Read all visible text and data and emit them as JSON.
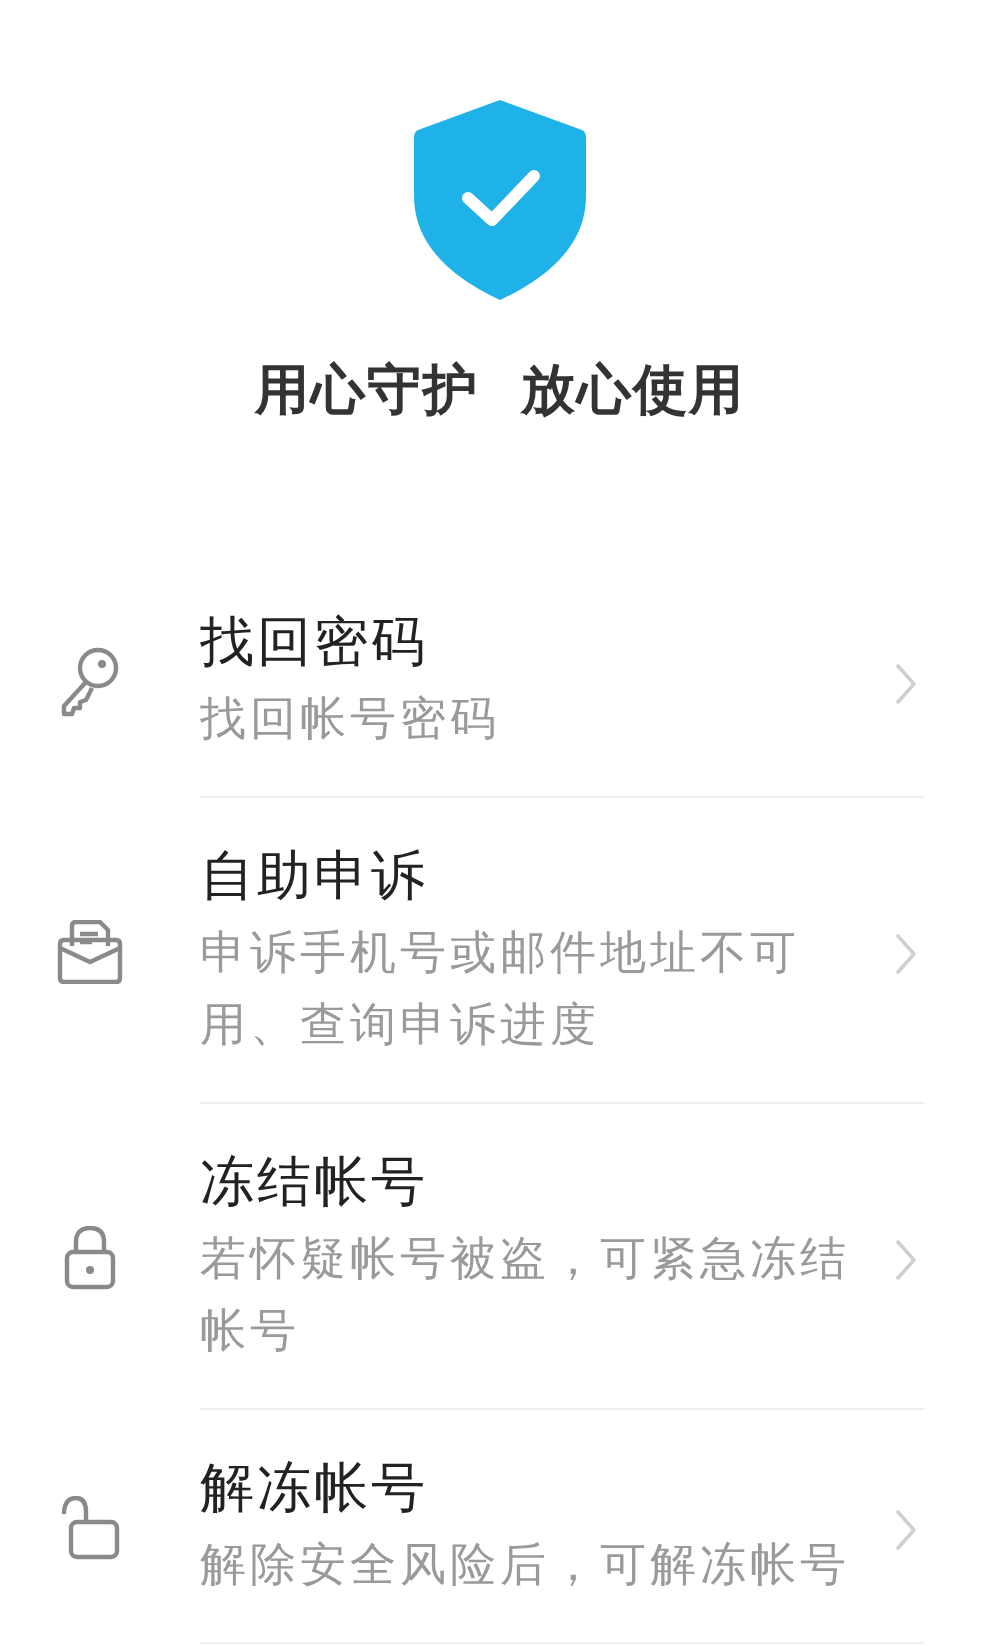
{
  "header": {
    "tagline": "用心守护  放心使用"
  },
  "items": [
    {
      "kind": "key",
      "title": "找回密码",
      "description": "找回帐号密码"
    },
    {
      "kind": "mail",
      "title": "自助申诉",
      "description": "申诉手机号或邮件地址不可用、查询申诉进度"
    },
    {
      "kind": "lock",
      "title": "冻结帐号",
      "description": "若怀疑帐号被盗，可紧急冻结帐号"
    },
    {
      "kind": "unlock",
      "title": "解冻帐号",
      "description": "解除安全风险后，可解冻帐号"
    }
  ]
}
